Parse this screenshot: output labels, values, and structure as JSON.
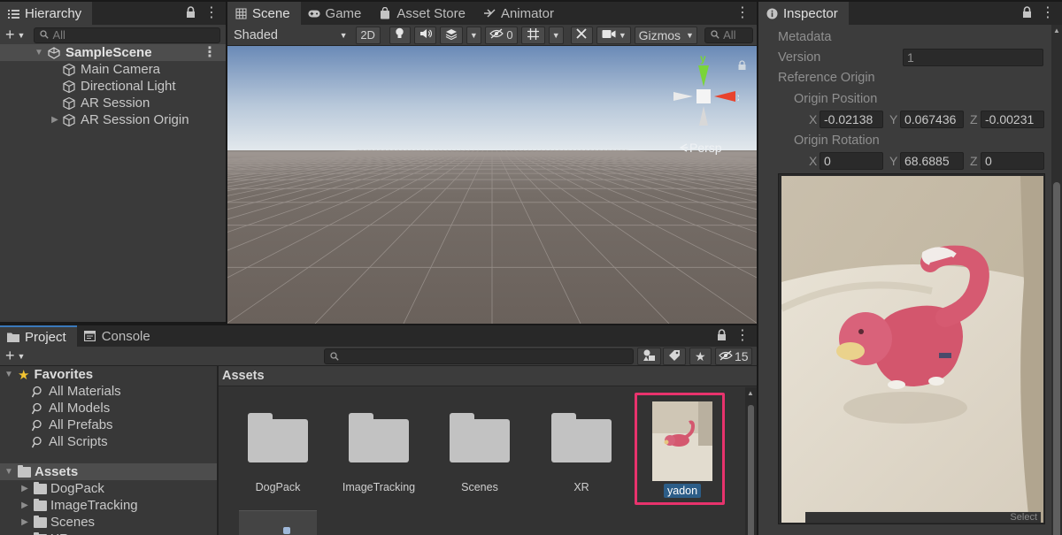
{
  "hierarchy": {
    "tab_label": "Hierarchy",
    "search_placeholder": "All",
    "scene_name": "SampleScene",
    "items": [
      {
        "label": "Main Camera"
      },
      {
        "label": "Directional Light"
      },
      {
        "label": "AR Session"
      },
      {
        "label": "AR Session Origin"
      }
    ]
  },
  "scene_view": {
    "tabs": [
      {
        "label": "Scene",
        "icon": "grid-icon"
      },
      {
        "label": "Game",
        "icon": "gamepad-icon"
      },
      {
        "label": "Asset Store",
        "icon": "bag-icon"
      },
      {
        "label": "Animator",
        "icon": "animator-icon"
      }
    ],
    "shading_mode": "Shaded",
    "mode_2d": "2D",
    "hidden_count": "0",
    "gizmos_label": "Gizmos",
    "search_placeholder": "All",
    "persp_label": "Persp",
    "axis_x": "x",
    "axis_y": "y",
    "colors": {
      "sky_top": "#6a8ab7",
      "sky_horizon": "#dfe7ec",
      "ground": "#6e6660",
      "axis_x": "#e8432d",
      "axis_y": "#7ad43a"
    }
  },
  "project": {
    "tabs": [
      {
        "label": "Project",
        "icon": "folder-icon"
      },
      {
        "label": "Console",
        "icon": "console-icon"
      }
    ],
    "hidden_count": "15",
    "favorites_label": "Favorites",
    "favorites": [
      {
        "label": "All Materials"
      },
      {
        "label": "All Models"
      },
      {
        "label": "All Prefabs"
      },
      {
        "label": "All Scripts"
      }
    ],
    "assets_root_label": "Assets",
    "tree_folders": [
      {
        "label": "DogPack"
      },
      {
        "label": "ImageTracking"
      },
      {
        "label": "Scenes"
      },
      {
        "label": "XR"
      }
    ],
    "breadcrumb": "Assets",
    "grid_items": [
      {
        "label": "DogPack"
      },
      {
        "label": "ImageTracking"
      },
      {
        "label": "Scenes"
      },
      {
        "label": "XR"
      },
      {
        "label": "yadon"
      }
    ],
    "selection_color": "#e8336d"
  },
  "inspector": {
    "tab_label": "Inspector",
    "metadata_label": "Metadata",
    "version_label": "Version",
    "version_value": "1",
    "reference_origin_label": "Reference Origin",
    "origin_position_label": "Origin Position",
    "origin_position": {
      "x": "-0.02138",
      "y": "0.067436",
      "z": "-0.00231"
    },
    "origin_rotation_label": "Origin Rotation",
    "origin_rotation": {
      "x": "0",
      "y": "68.6885",
      "z": "0"
    },
    "axis_labels": {
      "x": "X",
      "y": "Y",
      "z": "Z"
    },
    "preview_select_label": "Select"
  }
}
